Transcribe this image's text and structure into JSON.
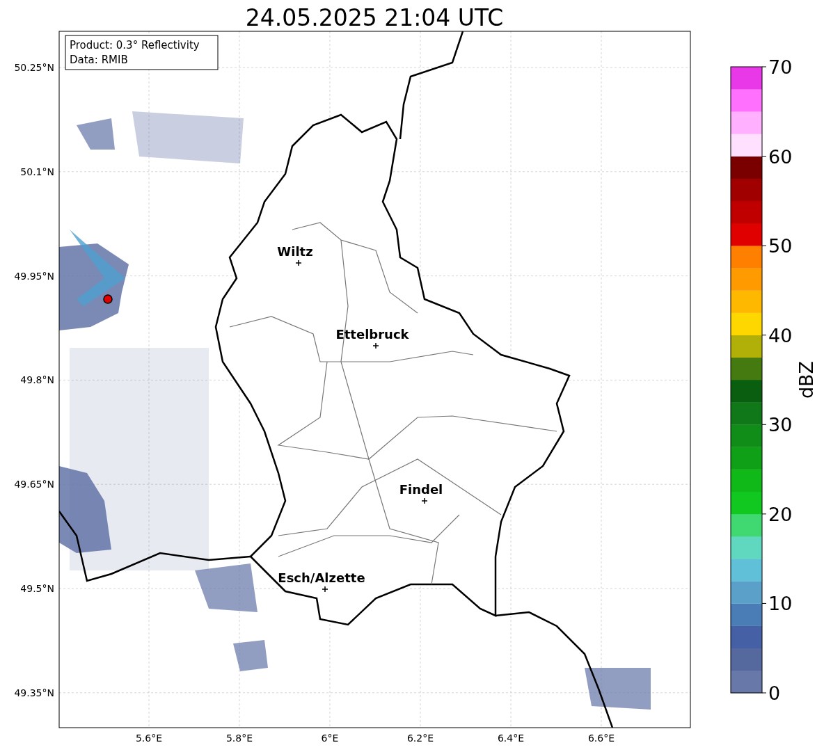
{
  "title": "24.05.2025 21:04 UTC",
  "map": {
    "info": [
      "Product: 0.3° Reflectivity",
      "Data: RMIB"
    ],
    "lat_ticks": [
      "50.25°N",
      "50.1°N",
      "49.95°N",
      "49.8°N",
      "49.65°N",
      "49.5°N",
      "49.35°N"
    ],
    "lon_ticks": [
      "5.6°E",
      "5.8°E",
      "6°E",
      "6.2°E",
      "6.4°E",
      "6.6°E"
    ],
    "places": [
      {
        "name": "Wiltz"
      },
      {
        "name": "Ettelbruck"
      },
      {
        "name": "Findel"
      },
      {
        "name": "Esch/Alzette"
      }
    ]
  },
  "colorbar": {
    "label": "dBZ",
    "ticks": [
      "70",
      "60",
      "50",
      "40",
      "30",
      "20",
      "10",
      "0"
    ],
    "bands": [
      {
        "color": "#6878a8"
      },
      {
        "color": "#56699f"
      },
      {
        "color": "#4560a5"
      },
      {
        "color": "#4a7cb5"
      },
      {
        "color": "#5aa0c8"
      },
      {
        "color": "#60c0d8"
      },
      {
        "color": "#60d8c0"
      },
      {
        "color": "#40d870"
      },
      {
        "color": "#10c820"
      },
      {
        "color": "#10b818"
      },
      {
        "color": "#10a018"
      },
      {
        "color": "#108c18"
      },
      {
        "color": "#107818"
      },
      {
        "color": "#0a5e10"
      },
      {
        "color": "#447a10"
      },
      {
        "color": "#b0b008"
      },
      {
        "color": "#ffd700"
      },
      {
        "color": "#ffb800"
      },
      {
        "color": "#ff9a00"
      },
      {
        "color": "#ff7f00"
      },
      {
        "color": "#e00000"
      },
      {
        "color": "#c00000"
      },
      {
        "color": "#a00000"
      },
      {
        "color": "#7a0000"
      },
      {
        "color": "#ffe0ff"
      },
      {
        "color": "#ffb0ff"
      },
      {
        "color": "#ff70ff"
      },
      {
        "color": "#e838e8"
      }
    ]
  }
}
